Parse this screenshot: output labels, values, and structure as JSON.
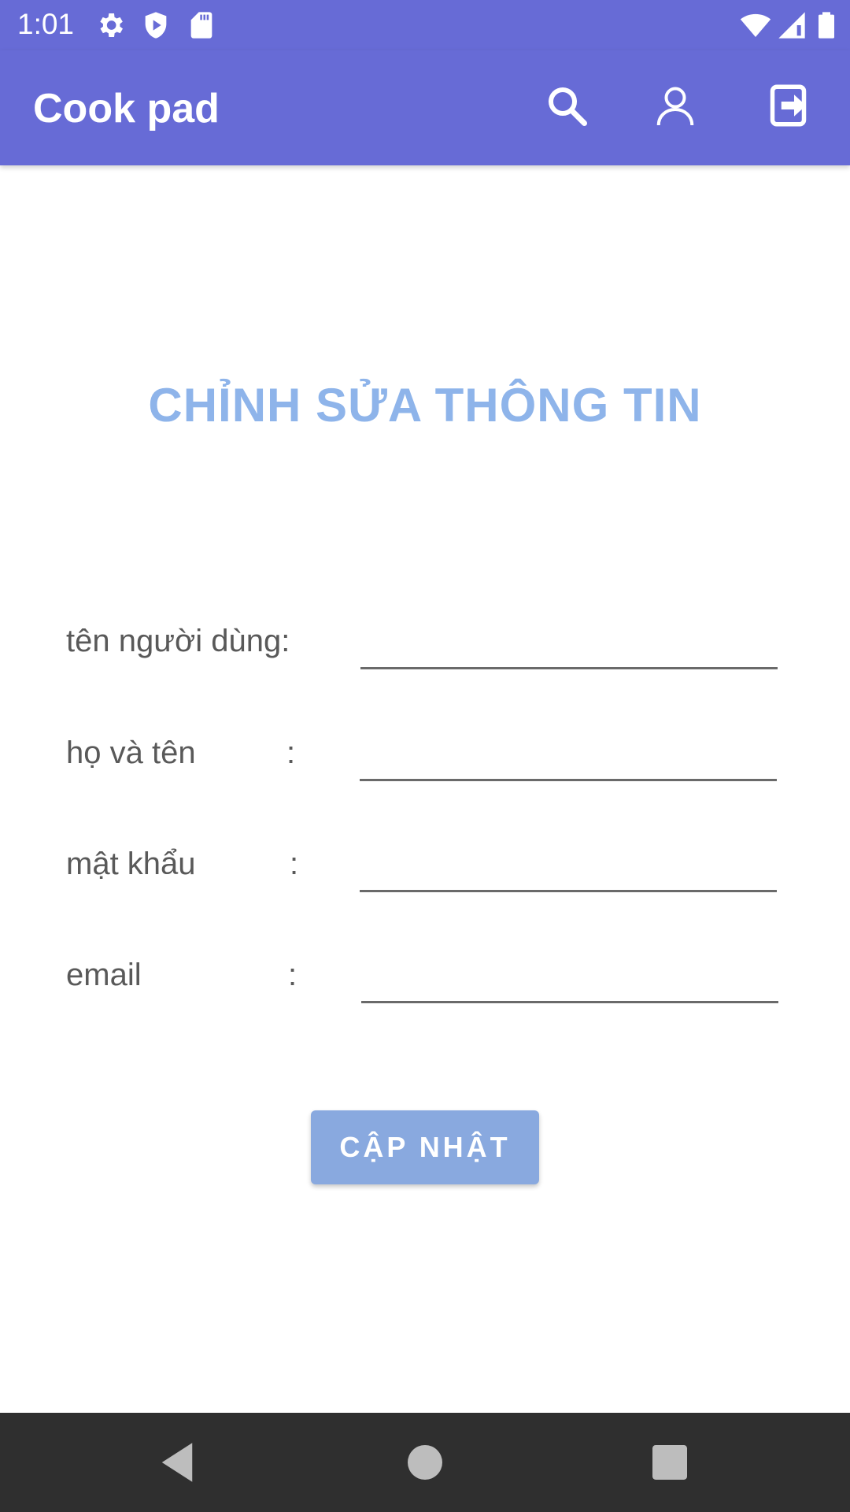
{
  "status_bar": {
    "time": "1:01",
    "left_icons": [
      "gear-icon",
      "shield-icon",
      "sd-card-icon"
    ],
    "right_icons": [
      "wifi-icon",
      "cell-signal-icon",
      "battery-icon"
    ]
  },
  "app_bar": {
    "title": "Cook pad",
    "actions": [
      "search-icon",
      "profile-icon",
      "logout-icon"
    ],
    "color": "#676bd6"
  },
  "page": {
    "heading": "CHỈNH SỬA THÔNG TIN",
    "heading_color": "#8eb4ea"
  },
  "form": {
    "fields": [
      {
        "label": "tên người dùng:",
        "colon": "",
        "value": ""
      },
      {
        "label": "họ và tên",
        "colon": ":",
        "value": ""
      },
      {
        "label": "mật khẩu",
        "colon": ":",
        "value": ""
      },
      {
        "label": "email",
        "colon": ":",
        "value": ""
      }
    ],
    "submit_label": "CẬP NHẬT",
    "submit_color": "#89a9df"
  },
  "nav_bar": {
    "buttons": [
      "back-icon",
      "home-icon",
      "recents-icon"
    ]
  }
}
